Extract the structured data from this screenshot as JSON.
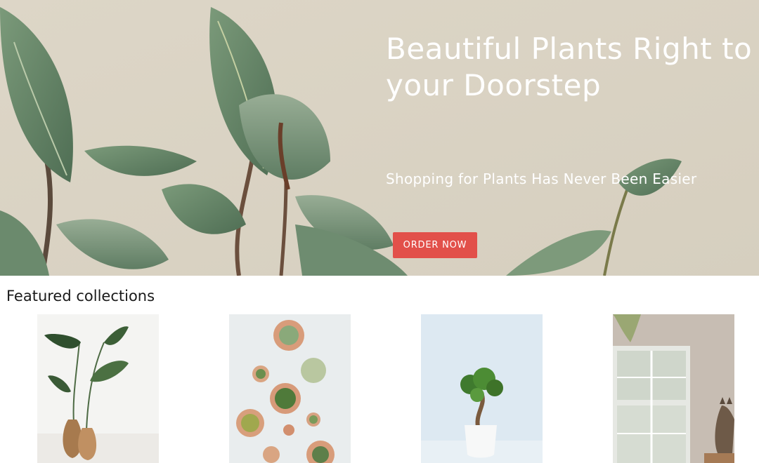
{
  "hero": {
    "title_line1": "Beautiful Plants Right to",
    "title_line2": "your Doorstep",
    "subtitle": "Shopping for Plants Has Never Been Easier",
    "cta_label": "ORDER NOW"
  },
  "featured": {
    "title": "Featured collections",
    "items": [
      {
        "image": "plant-in-wooden-vase-photo"
      },
      {
        "image": "succulents-top-view-photo"
      },
      {
        "image": "bonsai-in-white-pot-photo"
      },
      {
        "image": "cat-by-window-photo"
      }
    ]
  },
  "colors": {
    "cta": "#e2504a",
    "hero_bg": "#dcd5c6"
  }
}
